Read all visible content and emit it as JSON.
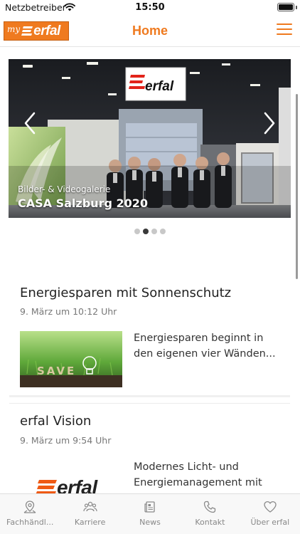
{
  "status_bar": {
    "carrier": "Netzbetreiber",
    "time": "15:50",
    "icons": [
      "wifi-icon",
      "battery-icon"
    ]
  },
  "header": {
    "logo_prefix": "my",
    "logo_text": "erfal",
    "title": "Home",
    "menu_icon": "hamburger-menu-icon",
    "accent_color": "#ef7a1f"
  },
  "carousel": {
    "subtitle": "Bilder- & Videogalerie",
    "title": "CASA Salzburg 2020",
    "sign_text": "erfal",
    "slide_count": 4,
    "active_index": 1
  },
  "news": [
    {
      "title": "Energiesparen mit Sonnenschutz",
      "date": "9. März um 10:12 Uhr",
      "excerpt": "Energiesparen beginnt in den eigenen vier Wänden...",
      "thumb_text": "SAVE"
    },
    {
      "title": "erfal Vision",
      "date": "9. März um 9:54 Uhr",
      "excerpt": "Modernes Licht- und Energiemanagement mit",
      "thumb_text": "erfal"
    }
  ],
  "tabs": [
    {
      "label": "Fachhändl...",
      "icon": "map-pin-icon"
    },
    {
      "label": "Karriere",
      "icon": "people-icon"
    },
    {
      "label": "News",
      "icon": "news-icon"
    },
    {
      "label": "Kontakt",
      "icon": "phone-icon"
    },
    {
      "label": "Über erfal",
      "icon": "heart-icon"
    }
  ]
}
